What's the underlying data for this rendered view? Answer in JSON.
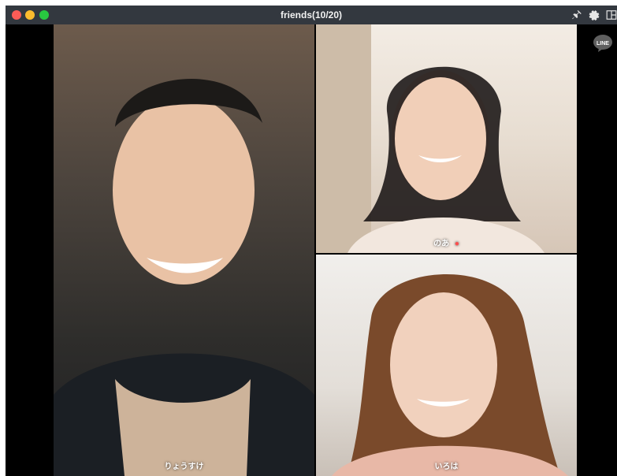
{
  "window": {
    "title": "friends(10/20)"
  },
  "participants": [
    {
      "name": "りょうすけ",
      "muted": false
    },
    {
      "name": "のあ",
      "muted": true
    },
    {
      "name": "いろは",
      "muted": false
    }
  ],
  "brand": {
    "logo_text": "LINE"
  },
  "colors": {
    "titlebar": "#33383f",
    "close": "#fc5c57",
    "minimize": "#fdbc2e",
    "maximize": "#28c840",
    "muted_icon": "#ff4d4d"
  },
  "icons": {
    "pin": "pin-icon",
    "settings": "gear-icon",
    "layout": "layout-icon",
    "mute": "microphone-muted-icon"
  }
}
